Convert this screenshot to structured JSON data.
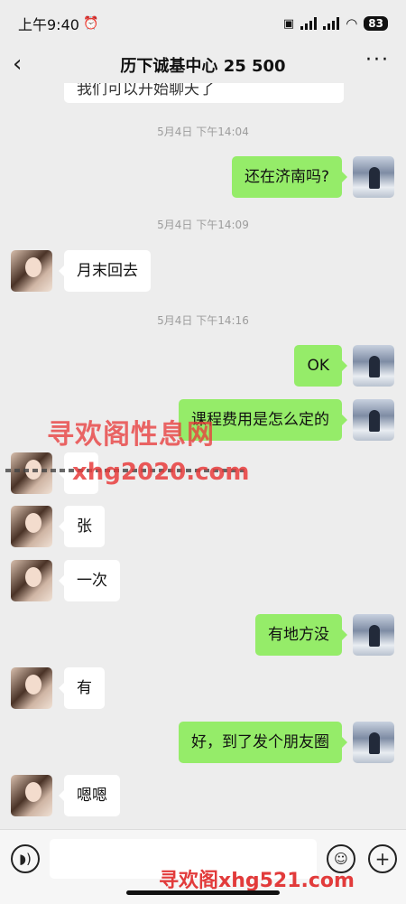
{
  "status_bar": {
    "time": "上午9:40",
    "battery": "83"
  },
  "header": {
    "title": "历下诚基中心 25 500"
  },
  "partial_message": "我们可以开始聊天了",
  "messages": [
    {
      "time": "5月4日 下午14:04"
    },
    {
      "text": "还在济南吗?"
    },
    {
      "time": "5月4日 下午14:09"
    },
    {
      "text": "月末回去"
    },
    {
      "time": "5月4日 下午14:16"
    },
    {
      "text": "OK"
    },
    {
      "text": "课程费用是怎么定的"
    },
    {
      "text": ""
    },
    {
      "text": "张"
    },
    {
      "text": "一次"
    },
    {
      "text": "有地方没"
    },
    {
      "text": "有"
    },
    {
      "text": "好，到了发个朋友圈"
    },
    {
      "text": "嗯嗯"
    }
  ],
  "watermarks": {
    "line1": "寻欢阁性息网",
    "line2": "xhg2020.com",
    "line3": "寻欢阁xhg521.com"
  },
  "colors": {
    "self_bubble": "#95ec69",
    "other_bubble": "#ffffff",
    "background": "#ededed"
  },
  "icons": {
    "voice": "voice-icon",
    "emoji": "emoji-icon",
    "plus": "plus-icon",
    "back": "back-arrow-icon",
    "more": "more-icon",
    "alarm": "alarm-icon"
  }
}
